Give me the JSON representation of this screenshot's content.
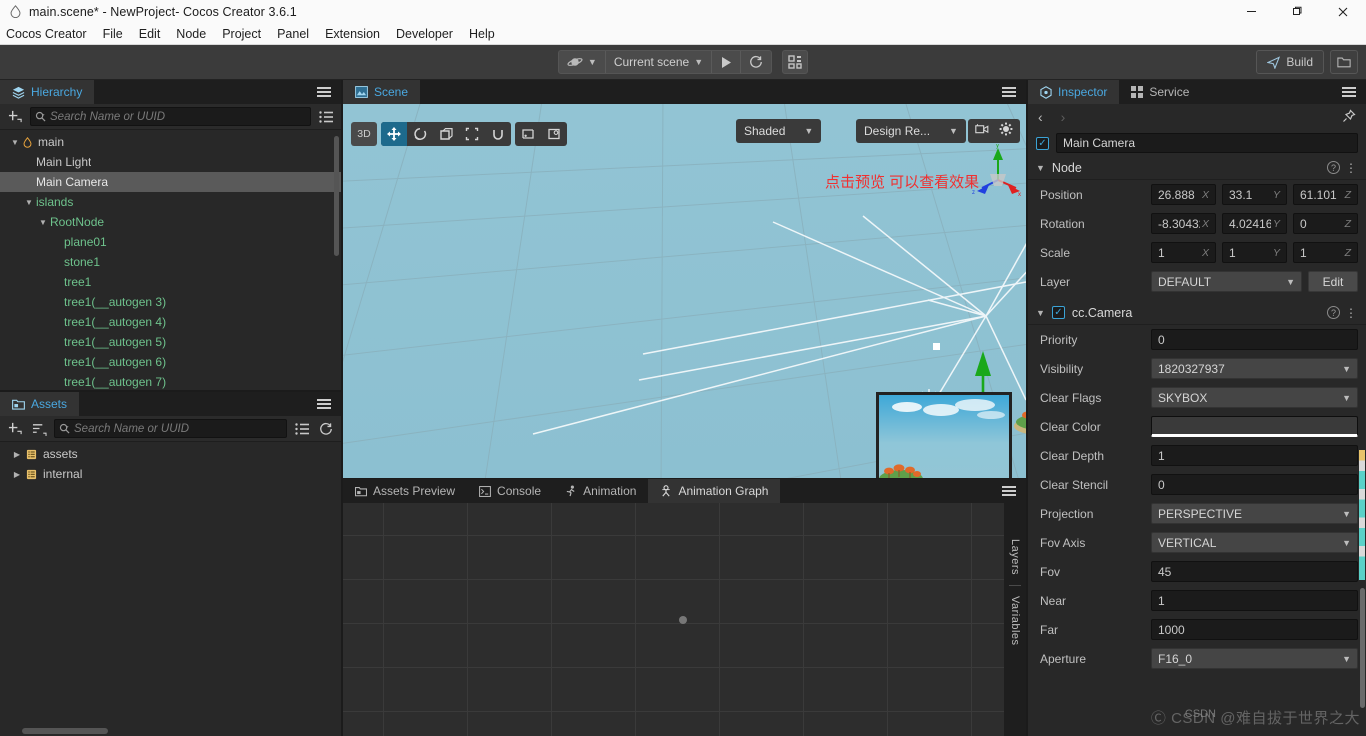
{
  "window": {
    "title": "main.scene* - NewProject- Cocos Creator 3.6.1",
    "app_icon": "cocos-logo-icon",
    "minimize": "—",
    "maximize": "❐",
    "close": "✕"
  },
  "menubar": {
    "items": [
      {
        "label": "Cocos Creator"
      },
      {
        "label": "File"
      },
      {
        "label": "Edit"
      },
      {
        "label": "Node"
      },
      {
        "label": "Project"
      },
      {
        "label": "Panel"
      },
      {
        "label": "Extension"
      },
      {
        "label": "Developer"
      },
      {
        "label": "Help"
      }
    ]
  },
  "toolbar": {
    "platform_icon": "saturn-planet-icon",
    "scene_selector": "Current scene",
    "play_icon": "play-triangle-icon",
    "refresh_icon": "refresh-circle-icon",
    "device_icon": "qr-grid-icon",
    "build_label": "Build",
    "build_icon": "paper-plane-icon",
    "folder_icon": "folder-open-icon"
  },
  "hierarchy": {
    "tab_label": "Hierarchy",
    "tab_icon": "layers-stack-icon",
    "add_icon": "add-node-icon",
    "search_icon": "magnifier-icon",
    "search_placeholder": "Search Name or UUID",
    "search_value": "",
    "list_icon": "list-view-icon",
    "nodes": [
      {
        "label": "main",
        "indent": 0,
        "twisty": "⌄",
        "icon": "scene-drop-icon",
        "color": "white",
        "selected": false
      },
      {
        "label": "Main Light",
        "indent": 1,
        "twisty": "",
        "icon": "",
        "color": "white",
        "selected": false
      },
      {
        "label": "Main Camera",
        "indent": 1,
        "twisty": "",
        "icon": "",
        "color": "white",
        "selected": true
      },
      {
        "label": "islands",
        "indent": 1,
        "twisty": "⌄",
        "icon": "",
        "color": "green",
        "selected": false
      },
      {
        "label": "RootNode",
        "indent": 2,
        "twisty": "⌄",
        "icon": "",
        "color": "green",
        "selected": false
      },
      {
        "label": "plane01",
        "indent": 3,
        "twisty": "",
        "icon": "",
        "color": "green",
        "selected": false
      },
      {
        "label": "stone1",
        "indent": 3,
        "twisty": "",
        "icon": "",
        "color": "green",
        "selected": false
      },
      {
        "label": "tree1",
        "indent": 3,
        "twisty": "",
        "icon": "",
        "color": "green",
        "selected": false
      },
      {
        "label": "tree1(__autogen 3)",
        "indent": 3,
        "twisty": "",
        "icon": "",
        "color": "green",
        "selected": false
      },
      {
        "label": "tree1(__autogen 4)",
        "indent": 3,
        "twisty": "",
        "icon": "",
        "color": "green",
        "selected": false
      },
      {
        "label": "tree1(__autogen 5)",
        "indent": 3,
        "twisty": "",
        "icon": "",
        "color": "green",
        "selected": false
      },
      {
        "label": "tree1(__autogen 6)",
        "indent": 3,
        "twisty": "",
        "icon": "",
        "color": "green",
        "selected": false
      },
      {
        "label": "tree1(__autogen 7)",
        "indent": 3,
        "twisty": "",
        "icon": "",
        "color": "green",
        "selected": false
      }
    ]
  },
  "assets": {
    "tab_label": "Assets",
    "tab_icon": "folder-icon",
    "add_icon": "add-asset-icon",
    "sort_icon": "sort-icon",
    "search_icon": "magnifier-icon",
    "search_placeholder": "Search Name or UUID",
    "search_value": "",
    "list_icon": "list-view-icon",
    "refresh_icon": "refresh-icon",
    "items": [
      {
        "label": "assets",
        "twisty": "›",
        "icon": "db-folder-icon"
      },
      {
        "label": "internal",
        "twisty": "›",
        "icon": "db-folder-icon"
      }
    ]
  },
  "scene": {
    "tab_label": "Scene",
    "tab_icon": "scene-image-icon",
    "btn_3d": "3D",
    "transform_tools": [
      {
        "name": "move-tool",
        "glyph": "✥",
        "active": true
      },
      {
        "name": "rotate-tool",
        "glyph": "↻",
        "active": false
      },
      {
        "name": "scale-tool",
        "glyph": "⤡",
        "active": false
      },
      {
        "name": "rect-tool",
        "glyph": "⬚",
        "active": false
      },
      {
        "name": "magnet-tool",
        "glyph": "∪",
        "active": false
      }
    ],
    "extra_tools": [
      {
        "name": "pivot-toggle",
        "glyph": "⬚"
      },
      {
        "name": "coord-toggle",
        "glyph": "▣"
      }
    ],
    "shading_mode": "Shaded",
    "gizmo_light_icon": "lightbulb-icon",
    "design_resolution": "Design Re...",
    "camera_icon": "camera-icon",
    "gear_icon": "gear-icon",
    "annotation": "点击预览 可以查看效果",
    "gizmo_axes": [
      "x",
      "y",
      "z"
    ],
    "preview_label": "camera-preview"
  },
  "bottom": {
    "tabs": [
      {
        "label": "Assets Preview",
        "icon": "folder-icon",
        "active": false
      },
      {
        "label": "Console",
        "icon": "terminal-icon",
        "active": false
      },
      {
        "label": "Animation",
        "icon": "anim-run-icon",
        "active": false
      },
      {
        "label": "Animation Graph",
        "icon": "anim-graph-icon",
        "active": true
      }
    ],
    "vertical_tabs": [
      "Layers",
      "Variables"
    ]
  },
  "inspector": {
    "tabs": [
      {
        "label": "Inspector",
        "icon": "cube-icon",
        "active": true
      },
      {
        "label": "Service",
        "icon": "grid-4-icon",
        "active": false
      }
    ],
    "nav_back": "‹",
    "nav_forward": "›",
    "pin_icon": "pin-icon",
    "node_enabled": true,
    "node_name": "Main Camera",
    "node_section": {
      "title": "Node",
      "help_icon": "question-circle-icon",
      "menu_icon": "kebab-menu-icon",
      "position": {
        "label": "Position",
        "x": "26.888",
        "y": "33.1",
        "z": "61.101"
      },
      "rotation": {
        "label": "Rotation",
        "x": "-8.30432",
        "y": "4.024165",
        "z": "0"
      },
      "scale": {
        "label": "Scale",
        "x": "1",
        "y": "1",
        "z": "1"
      },
      "layer": {
        "label": "Layer",
        "value": "DEFAULT",
        "edit_label": "Edit"
      }
    },
    "camera_section": {
      "title": "cc.Camera",
      "enabled": true,
      "help_icon": "question-circle-icon",
      "menu_icon": "kebab-menu-icon",
      "properties": [
        {
          "label": "Priority",
          "value": "0",
          "type": "input"
        },
        {
          "label": "Visibility",
          "value": "1820327937",
          "type": "select"
        },
        {
          "label": "Clear Flags",
          "value": "SKYBOX",
          "type": "select"
        },
        {
          "label": "Clear Color",
          "value": "",
          "type": "color"
        },
        {
          "label": "Clear Depth",
          "value": "1",
          "type": "input"
        },
        {
          "label": "Clear Stencil",
          "value": "0",
          "type": "input"
        },
        {
          "label": "Projection",
          "value": "PERSPECTIVE",
          "type": "select"
        },
        {
          "label": "Fov Axis",
          "value": "VERTICAL",
          "type": "select"
        },
        {
          "label": "Fov",
          "value": "45",
          "type": "input"
        },
        {
          "label": "Near",
          "value": "1",
          "type": "input"
        },
        {
          "label": "Far",
          "value": "1000",
          "type": "input"
        },
        {
          "label": "Aperture",
          "value": "F16_0",
          "type": "select"
        }
      ]
    }
  },
  "watermark": {
    "text": "CSDN @难自拔于世界之大",
    "badge": "Ⓒ"
  },
  "colors": {
    "accent": "#4aa8e0",
    "active_tool": "#1d6a8c",
    "tree_green": "#6ec28c",
    "viewport_bg": "#8fc2d2",
    "annotation_red": "#f03030"
  }
}
